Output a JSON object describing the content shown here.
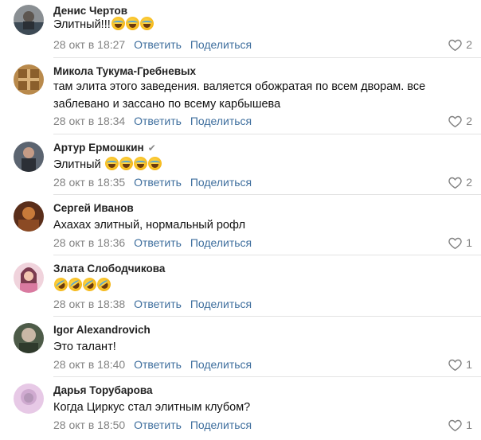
{
  "comments": [
    {
      "author": "Денис Чертов",
      "text": "Элитный!!!",
      "emojis": 3,
      "date": "28 окт в 18:27",
      "reply": "Ответить",
      "share": "Поделиться",
      "likes": "2",
      "avatar_colors": [
        "#8a8f93",
        "#3d4a55"
      ]
    },
    {
      "author": "Микола Тукума-Гребневых",
      "text": "там элита этого заведения. валяется обожратая по всем дворам. все заблевано и зассано по всему карбышева",
      "emojis": 0,
      "date": "28 окт в 18:34",
      "reply": "Ответить",
      "share": "Поделиться",
      "likes": "2",
      "avatar_colors": [
        "#b98a4c",
        "#6e4a22"
      ]
    },
    {
      "author": "Артур Ермошкин",
      "verified": true,
      "text": "Элитный",
      "emojis": 4,
      "date": "28 окт в 18:35",
      "reply": "Ответить",
      "share": "Поделиться",
      "likes": "2",
      "avatar_colors": [
        "#5b6470",
        "#2b2f36"
      ]
    },
    {
      "author": "Сергей Иванов",
      "text": "Ахахах элитный, нормальный рофл",
      "emojis": 0,
      "date": "28 окт в 18:36",
      "reply": "Ответить",
      "share": "Поделиться",
      "likes": "1",
      "avatar_colors": [
        "#c77a3a",
        "#5a2e1a"
      ]
    },
    {
      "author": "Злата Слободчикова",
      "text": "",
      "emojis": 4,
      "emoji_style": "rofl",
      "date": "28 окт в 18:38",
      "reply": "Ответить",
      "share": "Поделиться",
      "likes": "",
      "avatar_colors": [
        "#e8a9b6",
        "#7b3b4f"
      ]
    },
    {
      "author": "Igor Alexandrovich",
      "text": "Это талант!",
      "emojis": 0,
      "date": "28 окт в 18:40",
      "reply": "Ответить",
      "share": "Поделиться",
      "likes": "1",
      "avatar_colors": [
        "#c9b7a6",
        "#4d5b48"
      ]
    },
    {
      "author": "Дарья Торубарова",
      "text": "Когда Циркус стал элитным клубом?",
      "emojis": 0,
      "date": "28 окт в 18:50",
      "reply": "Ответить",
      "share": "Поделиться",
      "likes": "1",
      "avatar_colors": [
        "#e7c9e6",
        "#a48aa9"
      ]
    }
  ]
}
